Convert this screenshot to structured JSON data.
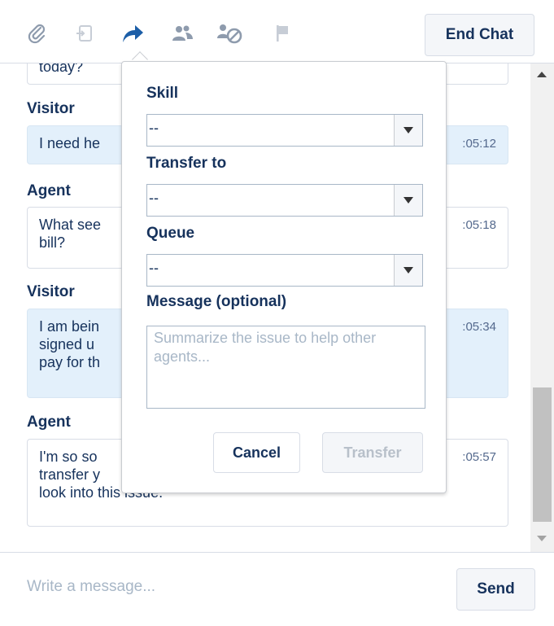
{
  "toolbar": {
    "icons": [
      "paperclip-icon",
      "file-transfer-icon",
      "transfer-icon",
      "conference-icon",
      "block-visitor-icon",
      "flag-icon"
    ],
    "active_icon": "transfer-icon",
    "end_chat_label": "End Chat",
    "accent_color": "#1c5ea7"
  },
  "transcript": {
    "top_partial_text": "today?",
    "messages": [
      {
        "sender": "Visitor",
        "text_visible": "I need he",
        "time": ":05:12"
      },
      {
        "sender": "Agent",
        "text_visible": [
          "What see",
          "bill?"
        ],
        "time": ":05:18"
      },
      {
        "sender": "Visitor",
        "text_visible": [
          "I am bein",
          "signed u",
          "pay for th"
        ],
        "time": ":05:34"
      },
      {
        "sender": "Agent",
        "text_visible": [
          "I'm so so",
          "transfer y",
          "look into this issue."
        ],
        "time": ":05:57"
      }
    ]
  },
  "transfer_popover": {
    "skill_label": "Skill",
    "skill_value": "--",
    "transfer_to_label": "Transfer to",
    "transfer_to_value": "--",
    "queue_label": "Queue",
    "queue_value": "--",
    "message_label": "Message (optional)",
    "message_placeholder": "Summarize the issue to help other agents...",
    "cancel_label": "Cancel",
    "transfer_label": "Transfer"
  },
  "compose": {
    "placeholder": "Write a message...",
    "send_label": "Send"
  }
}
